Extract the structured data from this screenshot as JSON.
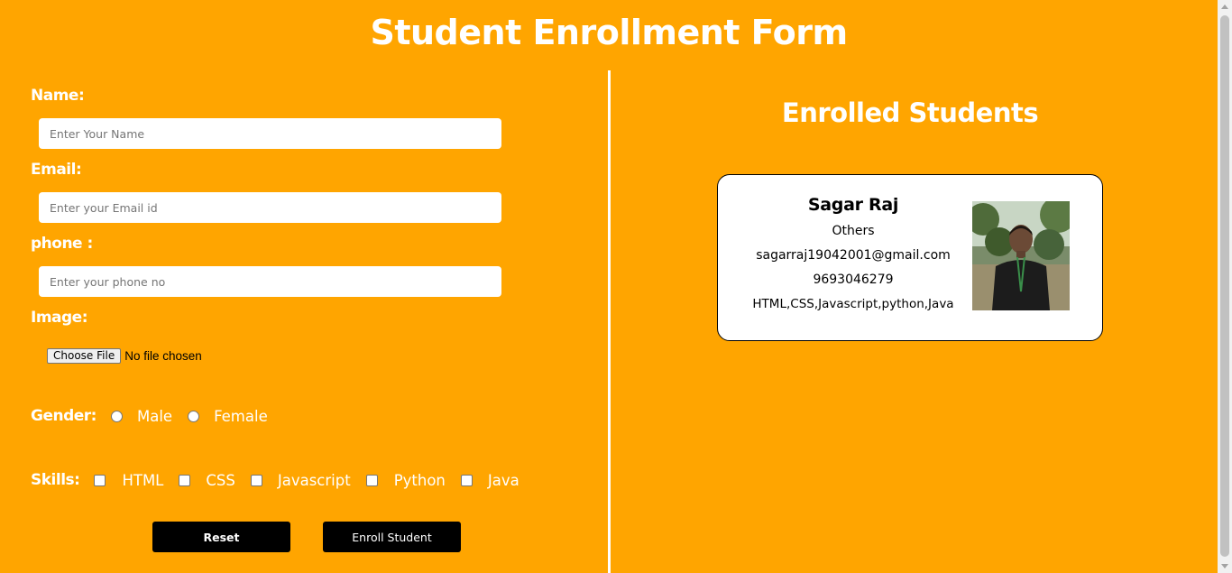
{
  "header": {
    "title": "Student Enrollment Form"
  },
  "form": {
    "name_label": "Name:",
    "name_placeholder": "Enter Your Name",
    "name_value": "",
    "email_label": "Email:",
    "email_placeholder": "Enter your Email id",
    "email_value": "",
    "phone_label": "phone :",
    "phone_placeholder": "Enter your phone no",
    "phone_value": "",
    "image_label": "Image:",
    "file_button_label": "Choose File",
    "file_status": "No file chosen",
    "gender_label": "Gender:",
    "gender_options": [
      "Male",
      "Female"
    ],
    "skills_label": "Skills:",
    "skill_options": [
      "HTML",
      "CSS",
      "Javascript",
      "Python",
      "Java"
    ],
    "reset_label": "Reset",
    "enroll_label": "Enroll Student"
  },
  "enrolled": {
    "title": "Enrolled Students",
    "students": [
      {
        "name": "Sagar Raj",
        "gender": "Others",
        "email": "sagarraj19042001@gmail.com",
        "phone": "9693046279",
        "skills": "HTML,CSS,Javascript,python,Java",
        "photo_icon": "student-photo"
      }
    ]
  },
  "colors": {
    "background": "#ffa500",
    "text_light": "#ffffff",
    "button_bg": "#000000",
    "card_bg": "#ffffff"
  }
}
